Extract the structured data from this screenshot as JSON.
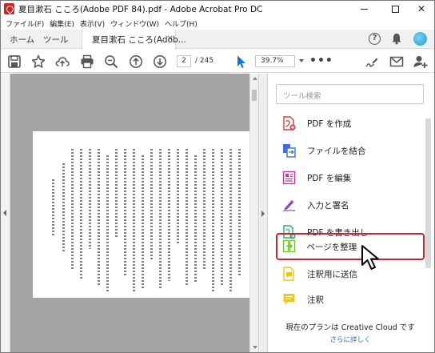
{
  "window": {
    "title": "夏目漱石 こころ(Adobe PDF 84).pdf - Adobe Acrobat Pro DC",
    "minimize": "—",
    "maximize": "☐",
    "close": "✕"
  },
  "menubar": {
    "items": [
      "ファイル(F)",
      "編集(E)",
      "表示(V)",
      "ウィンドウ(W)",
      "ヘルプ(H)"
    ]
  },
  "tabs": {
    "home": "ホーム",
    "tools": "ツール",
    "document": "夏目漱石 こころ(Adob...",
    "close": "×"
  },
  "header_icons": {
    "help": "?",
    "notifications": "bell-icon",
    "account": "avatar"
  },
  "toolbar": {
    "icons": [
      "save-icon",
      "star-icon",
      "cloud-upload-icon",
      "print-icon",
      "zoom-search-icon",
      "page-up-icon",
      "page-down-icon",
      "select-cursor-icon"
    ],
    "page_current": "2",
    "page_total": "/ 245",
    "zoom": "39.7%",
    "more": "•••",
    "right_icons": [
      "sign-icon",
      "mail-icon",
      "add-user-icon"
    ]
  },
  "tools_pane": {
    "search_placeholder": "ツール検索",
    "items": [
      {
        "label": "PDF を作成",
        "icon": "create-pdf-icon",
        "color": "#e03c3c"
      },
      {
        "label": "ファイルを結合",
        "icon": "combine-files-icon",
        "color": "#3d6fd6"
      },
      {
        "label": "PDF を編集",
        "icon": "edit-pdf-icon",
        "color": "#d6339b"
      },
      {
        "label": "入力と署名",
        "icon": "fill-sign-icon",
        "color": "#8a4fc9"
      },
      {
        "label": "PDF を書き出し",
        "icon": "export-pdf-icon",
        "color": "#2ba871"
      },
      {
        "label": "ページを整理",
        "icon": "organize-pages-icon",
        "color": "#6fbf2a",
        "highlighted": true
      },
      {
        "label": "注釈用に送信",
        "icon": "send-comments-icon",
        "color": "#f0c419"
      },
      {
        "label": "注釈",
        "icon": "comment-icon",
        "color": "#f0c419"
      }
    ],
    "plan_text": "現在のプランは Creative Cloud です",
    "plan_link": "さらに詳しく"
  },
  "colors": {
    "accent_red": "#d81e2b",
    "link_blue": "#2d6ec2",
    "doc_background": "#a3a3a3"
  }
}
